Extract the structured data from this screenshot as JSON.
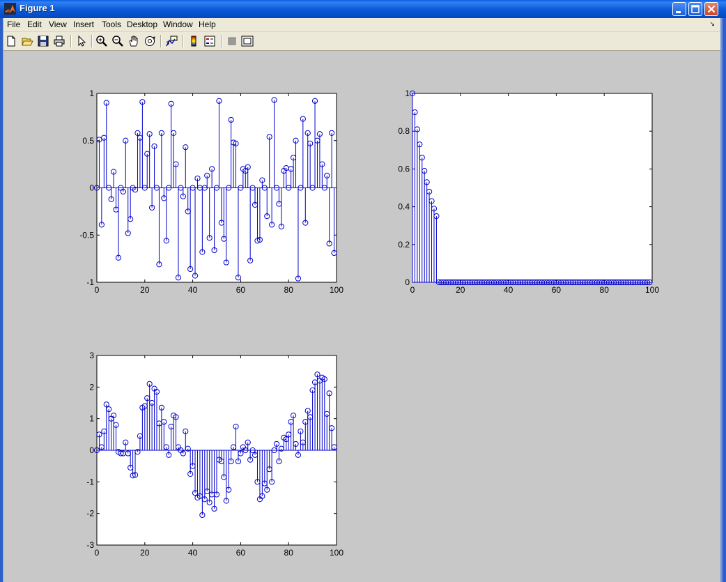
{
  "window": {
    "title": "Figure 1",
    "colors": {
      "titlebar": "#0a58d6",
      "figure_bg": "#c8c8c8",
      "menubar": "#ece9d8",
      "stem": "#0000cc"
    }
  },
  "menu": {
    "items": [
      {
        "id": "file",
        "label": "File"
      },
      {
        "id": "edit",
        "label": "Edit"
      },
      {
        "id": "view",
        "label": "View"
      },
      {
        "id": "insert",
        "label": "Insert"
      },
      {
        "id": "tools",
        "label": "Tools"
      },
      {
        "id": "desktop",
        "label": "Desktop"
      },
      {
        "id": "window",
        "label": "Window"
      },
      {
        "id": "help",
        "label": "Help"
      }
    ],
    "dock_arrow": "↘"
  },
  "toolbar": {
    "buttons": [
      {
        "id": "new-figure",
        "icon": "new-file-icon"
      },
      {
        "id": "open-file",
        "icon": "open-folder-icon"
      },
      {
        "id": "save-figure",
        "icon": "save-icon"
      },
      {
        "id": "print-figure",
        "icon": "print-icon"
      },
      {
        "id": "edit-plot",
        "icon": "pointer-icon"
      },
      {
        "id": "zoom-in",
        "icon": "zoom-in-icon"
      },
      {
        "id": "zoom-out",
        "icon": "zoom-out-icon"
      },
      {
        "id": "pan",
        "icon": "hand-icon"
      },
      {
        "id": "rotate-3d",
        "icon": "rotate-icon"
      },
      {
        "id": "data-cursor",
        "icon": "data-cursor-icon"
      },
      {
        "id": "insert-colorbar",
        "icon": "colorbar-icon"
      },
      {
        "id": "insert-legend",
        "icon": "legend-icon"
      },
      {
        "id": "hide-plot-tools",
        "icon": "hide-tools-icon"
      },
      {
        "id": "show-plot-tools",
        "icon": "show-tools-icon"
      }
    ]
  },
  "chart_data": [
    {
      "type": "stem",
      "xlim": [
        0,
        100
      ],
      "ylim": [
        -1,
        1
      ],
      "xticks": [
        0,
        20,
        40,
        60,
        80,
        100
      ],
      "yticks": [
        -1,
        -0.5,
        0,
        0.5,
        1
      ],
      "xtick_labels": [
        "0",
        "20",
        "40",
        "60",
        "80",
        "100"
      ],
      "ytick_labels": [
        "-1",
        "-0.5",
        "0",
        "0.5",
        "1"
      ],
      "x": [
        0,
        1,
        2,
        3,
        4,
        5,
        6,
        7,
        8,
        9,
        10,
        11,
        12,
        13,
        14,
        15,
        16,
        17,
        18,
        19,
        20,
        21,
        22,
        23,
        24,
        25,
        26,
        27,
        28,
        29,
        30,
        31,
        32,
        33,
        34,
        35,
        36,
        37,
        38,
        39,
        40,
        41,
        42,
        43,
        44,
        45,
        46,
        47,
        48,
        49,
        50,
        51,
        52,
        53,
        54,
        55,
        56,
        57,
        58,
        59,
        60,
        61,
        62,
        63,
        64,
        65,
        66,
        67,
        68,
        69,
        70,
        71,
        72,
        73,
        74,
        75,
        76,
        77,
        78,
        79,
        80,
        81,
        82,
        83,
        84,
        85,
        86,
        87,
        88,
        89,
        90,
        91,
        92,
        93,
        94,
        95,
        96,
        97,
        98,
        99
      ],
      "values": [
        0,
        0.51,
        -0.39,
        0.53,
        0.9,
        0,
        -0.12,
        0.17,
        -0.23,
        -0.74,
        0,
        -0.04,
        0.5,
        -0.48,
        -0.33,
        0,
        -0.02,
        0.58,
        0.53,
        0.91,
        0,
        0.36,
        0.57,
        -0.21,
        0.44,
        0,
        -0.81,
        0.58,
        -0.11,
        -0.56,
        0,
        0.89,
        0.58,
        0.25,
        -0.95,
        0,
        -0.09,
        0.43,
        -0.25,
        -0.86,
        0,
        -0.93,
        0.1,
        0,
        -0.68,
        0,
        0.13,
        -0.53,
        0.2,
        -0.66,
        0,
        0.92,
        -0.37,
        -0.54,
        -0.79,
        0,
        0.72,
        0.48,
        0.47,
        -0.95,
        0,
        0.2,
        0.18,
        0.22,
        -0.77,
        0,
        -0.18,
        -0.56,
        -0.55,
        0.08,
        0,
        -0.3,
        0.54,
        -0.39,
        0.93,
        0,
        -0.17,
        -0.41,
        0.18,
        0.21,
        0,
        0.2,
        0.32,
        0.5,
        -0.96,
        0,
        0.73,
        -0.37,
        0.58,
        0.47,
        0,
        0.92,
        0.5,
        0.57,
        0.25,
        0,
        0.13,
        -0.59,
        0.58,
        -0.69
      ]
    },
    {
      "type": "stem",
      "xlim": [
        0,
        100
      ],
      "ylim": [
        0,
        1
      ],
      "xticks": [
        0,
        20,
        40,
        60,
        80,
        100
      ],
      "yticks": [
        0,
        0.2,
        0.4,
        0.6,
        0.8,
        1
      ],
      "xtick_labels": [
        "0",
        "20",
        "40",
        "60",
        "80",
        "100"
      ],
      "ytick_labels": [
        "0",
        "0.2",
        "0.4",
        "0.6",
        "0.8",
        "1"
      ],
      "x": [
        0,
        1,
        2,
        3,
        4,
        5,
        6,
        7,
        8,
        9,
        10,
        11,
        12,
        13,
        14,
        15,
        16,
        17,
        18,
        19,
        20,
        21,
        22,
        23,
        24,
        25,
        26,
        27,
        28,
        29,
        30,
        31,
        32,
        33,
        34,
        35,
        36,
        37,
        38,
        39,
        40,
        41,
        42,
        43,
        44,
        45,
        46,
        47,
        48,
        49,
        50,
        51,
        52,
        53,
        54,
        55,
        56,
        57,
        58,
        59,
        60,
        61,
        62,
        63,
        64,
        65,
        66,
        67,
        68,
        69,
        70,
        71,
        72,
        73,
        74,
        75,
        76,
        77,
        78,
        79,
        80,
        81,
        82,
        83,
        84,
        85,
        86,
        87,
        88,
        89,
        90,
        91,
        92,
        93,
        94,
        95,
        96,
        97,
        98,
        99
      ],
      "values": [
        1,
        0.9,
        0.81,
        0.73,
        0.66,
        0.59,
        0.53,
        0.48,
        0.43,
        0.39,
        0.35,
        0,
        0,
        0,
        0,
        0,
        0,
        0,
        0,
        0,
        0,
        0,
        0,
        0,
        0,
        0,
        0,
        0,
        0,
        0,
        0,
        0,
        0,
        0,
        0,
        0,
        0,
        0,
        0,
        0,
        0,
        0,
        0,
        0,
        0,
        0,
        0,
        0,
        0,
        0,
        0,
        0,
        0,
        0,
        0,
        0,
        0,
        0,
        0,
        0,
        0,
        0,
        0,
        0,
        0,
        0,
        0,
        0,
        0,
        0,
        0,
        0,
        0,
        0,
        0,
        0,
        0,
        0,
        0,
        0,
        0,
        0,
        0,
        0,
        0,
        0,
        0,
        0,
        0,
        0,
        0,
        0,
        0,
        0,
        0,
        0,
        0,
        0,
        0,
        0
      ]
    },
    {
      "type": "stem",
      "xlim": [
        0,
        100
      ],
      "ylim": [
        -3,
        3
      ],
      "xticks": [
        0,
        20,
        40,
        60,
        80,
        100
      ],
      "yticks": [
        -3,
        -2,
        -1,
        0,
        1,
        2,
        3
      ],
      "xtick_labels": [
        "0",
        "20",
        "40",
        "60",
        "80",
        "100"
      ],
      "ytick_labels": [
        "-3",
        "-2",
        "-1",
        "0",
        "1",
        "2",
        "3"
      ],
      "x": [
        0,
        1,
        2,
        3,
        4,
        5,
        6,
        7,
        8,
        9,
        10,
        11,
        12,
        13,
        14,
        15,
        16,
        17,
        18,
        19,
        20,
        21,
        22,
        23,
        24,
        25,
        26,
        27,
        28,
        29,
        30,
        31,
        32,
        33,
        34,
        35,
        36,
        37,
        38,
        39,
        40,
        41,
        42,
        43,
        44,
        45,
        46,
        47,
        48,
        49,
        50,
        51,
        52,
        53,
        54,
        55,
        56,
        57,
        58,
        59,
        60,
        61,
        62,
        63,
        64,
        65,
        66,
        67,
        68,
        69,
        70,
        71,
        72,
        73,
        74,
        75,
        76,
        77,
        78,
        79,
        80,
        81,
        82,
        83,
        84,
        85,
        86,
        87,
        88,
        89,
        90,
        91,
        92,
        93,
        94,
        95,
        96,
        97,
        98,
        99
      ],
      "values": [
        0,
        0.5,
        0.1,
        0.6,
        1.45,
        1.3,
        1,
        1.1,
        0.8,
        -0.05,
        -0.1,
        -0.1,
        0.25,
        -0.1,
        -0.55,
        -0.8,
        -0.78,
        -0.05,
        0.45,
        1.35,
        1.4,
        1.65,
        2.1,
        1.5,
        1.95,
        1.85,
        0.85,
        1.35,
        0.9,
        0.1,
        -0.15,
        0.75,
        1.1,
        1.05,
        0.1,
        0,
        -0.1,
        0.6,
        0.05,
        -0.75,
        -0.5,
        -1.35,
        -1.5,
        -1.45,
        -2.05,
        -1.55,
        -1.3,
        -1.65,
        -1.4,
        -1.85,
        -1.4,
        -0.3,
        -0.35,
        -0.85,
        -1.6,
        -1.25,
        -0.35,
        0.1,
        0.75,
        -0.35,
        -0.1,
        0.1,
        0,
        0.25,
        -0.3,
        0,
        -0.15,
        -1,
        -1.55,
        -1.45,
        -1.05,
        -1.25,
        -0.6,
        -1,
        0,
        0.2,
        -0.35,
        0.05,
        0.4,
        0.35,
        0.5,
        0.9,
        1.1,
        0.2,
        -0.15,
        0.6,
        0.25,
        0.9,
        1.25,
        1.05,
        1.9,
        2.15,
        2.4,
        2.2,
        2.3,
        2.25,
        1.15,
        1.8,
        0.7,
        0.1
      ]
    }
  ]
}
